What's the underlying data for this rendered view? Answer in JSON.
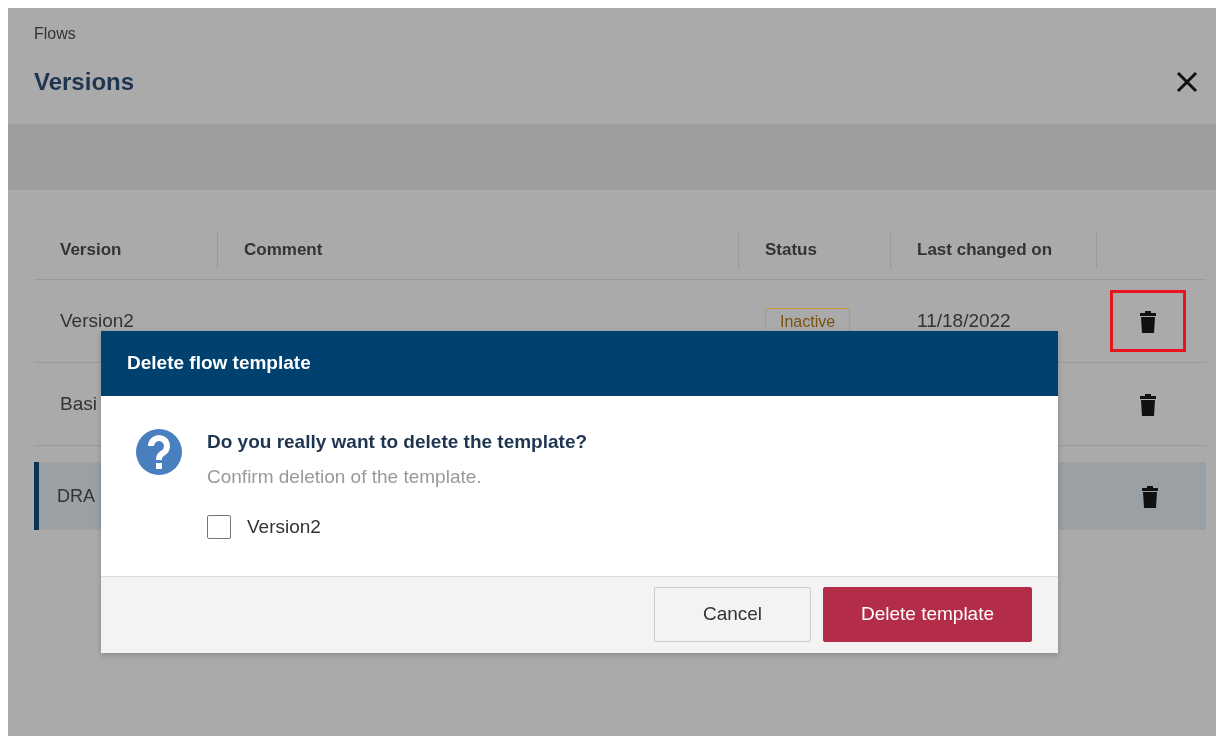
{
  "breadcrumb": "Flows",
  "title": "Versions",
  "table": {
    "columns": [
      "Version",
      "Comment",
      "Status",
      "Last changed on"
    ],
    "rows": [
      {
        "version": "Version2",
        "status": "Inactive",
        "date": "11/18/2022",
        "selected": false,
        "highlighted": true
      },
      {
        "version": "Basi",
        "selected": false,
        "highlighted": false
      },
      {
        "version": "DRA",
        "selected": true,
        "highlighted": false
      }
    ]
  },
  "dialog": {
    "title": "Delete flow template",
    "question": "Do you really want to delete the template?",
    "hint": "Confirm deletion of the template.",
    "items": [
      {
        "label": "Version2",
        "checked": false
      }
    ],
    "buttons": [
      {
        "label": "Cancel",
        "kind": "secondary"
      },
      {
        "label": "Delete template",
        "kind": "danger"
      }
    ]
  }
}
